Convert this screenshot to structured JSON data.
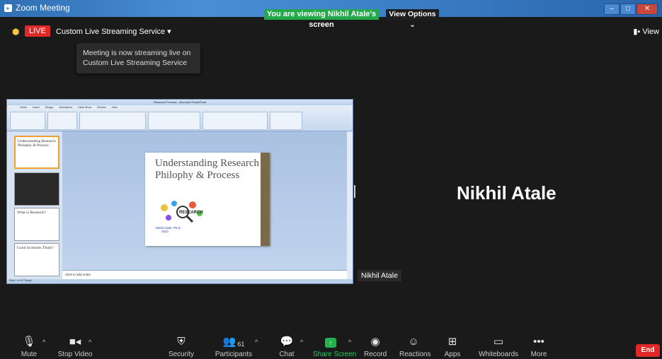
{
  "window": {
    "title": "Zoom Meeting",
    "viewing_banner": "You are viewing Nikhil Atale's screen",
    "view_options": "View Options ⌄"
  },
  "topbar": {
    "live_label": "LIVE",
    "streaming_service": "Custom Live Streaming Service ▾",
    "view_label": "View"
  },
  "tooltip": {
    "line1": "Meeting is now streaming live on",
    "line2": "Custom Live Streaming Service"
  },
  "shared_screen": {
    "app_title": "Research Process - Microsoft PowerPoint",
    "ribbon_tabs": [
      "Home",
      "Insert",
      "Design",
      "Animations",
      "Slide Show",
      "Review",
      "View"
    ],
    "slide_title": "Understanding Research Philophy & Process",
    "slide_image_text": "RESEARCH",
    "slide_author": "Nikhil Atale, Ph.D.",
    "slide_year": "2022",
    "notes_placeholder": "Click to add notes",
    "status": "Slide 1 of 15   \"Equity\"",
    "thumbnails": [
      {
        "title": "Understanding Research Philophy & Process"
      },
      {
        "title": ""
      },
      {
        "title": "What is Research?"
      },
      {
        "title": "Good Scientists Think?"
      }
    ]
  },
  "participant": {
    "name_label": "Nikhil Atale",
    "big_name": "Nikhil Atale"
  },
  "toolbar": {
    "mute": "Mute",
    "stop_video": "Stop Video",
    "security": "Security",
    "participants": "Participants",
    "participants_count": "61",
    "chat": "Chat",
    "share_screen": "Share Screen",
    "record": "Record",
    "reactions": "Reactions",
    "apps": "Apps",
    "whiteboards": "Whiteboards",
    "more": "More",
    "end": "End"
  },
  "colors": {
    "live_red": "#e02828",
    "share_green": "#23a94a",
    "background": "#1a1a1a"
  }
}
